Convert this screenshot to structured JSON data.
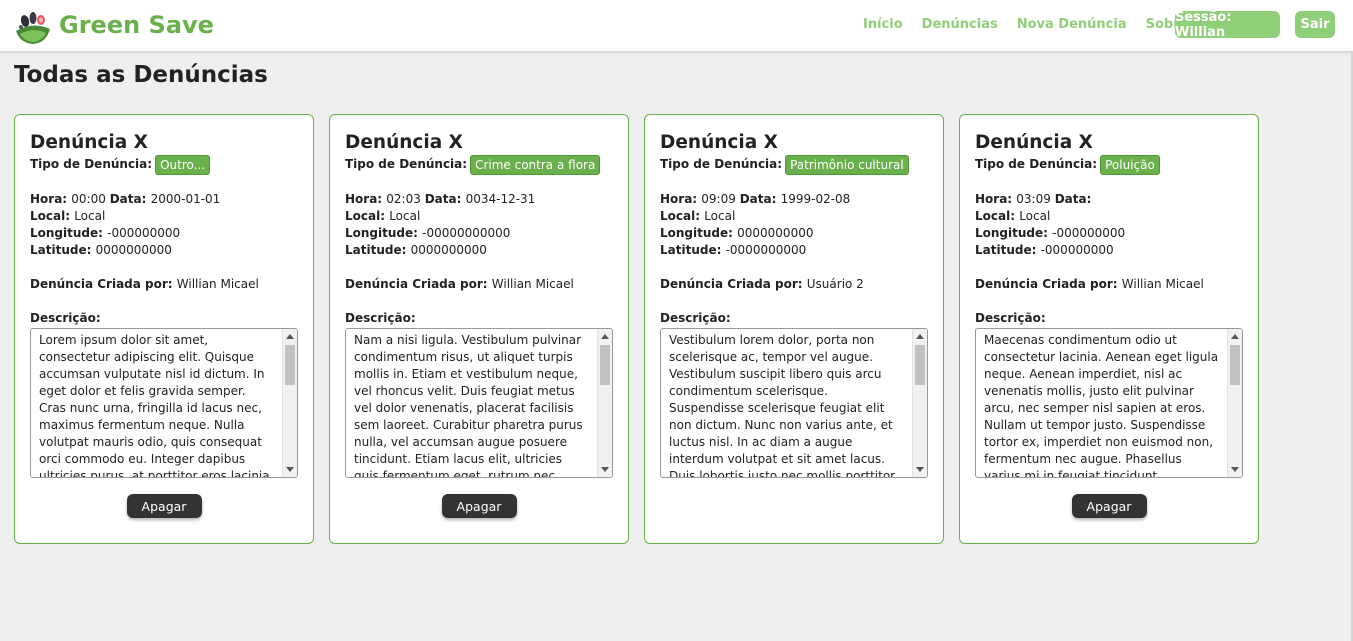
{
  "header": {
    "brand": "Green Save",
    "nav": [
      "Início",
      "Denúncias",
      "Nova Denúncia",
      "Sobre"
    ],
    "session_label": "Sessão: Willian",
    "logout_label": "Sair"
  },
  "page": {
    "title": "Todas as Denúncias"
  },
  "labels": {
    "tipo": "Tipo de Denúncia:",
    "hora": "Hora:",
    "data": "Data:",
    "local": "Local:",
    "longitude": "Longitude:",
    "latitude": "Latitude:",
    "criada_por": "Denúncia Criada por:",
    "descricao": "Descrição:"
  },
  "cards": [
    {
      "title": "Denúncia X",
      "tipo": "Outro...",
      "hora": "00:00",
      "data": "2000-01-01",
      "local": "Local",
      "longitude": "-000000000",
      "latitude": "0000000000",
      "criada_por": "Willian Micael",
      "descricao": "Lorem ipsum dolor sit amet, consectetur adipiscing elit. Quisque accumsan vulputate nisl id dictum. In eget dolor et felis gravida semper. Cras nunc urna, fringilla id lacus nec, maximus fermentum neque. Nulla volutpat mauris odio, quis consequat orci commodo eu. Integer dapibus ultricies purus, at porttitor eros lacinia eu. Donec lacinia",
      "delete_label": "Apagar",
      "show_delete": true
    },
    {
      "title": "Denúncia X",
      "tipo": "Crime contra a flora",
      "hora": "02:03",
      "data": "0034-12-31",
      "local": "Local",
      "longitude": "-00000000000",
      "latitude": "0000000000",
      "criada_por": "Willian Micael",
      "descricao": "Nam a nisi ligula. Vestibulum pulvinar condimentum risus, ut aliquet turpis mollis in. Etiam et vestibulum neque, vel rhoncus velit. Duis feugiat metus vel dolor venenatis, placerat facilisis sem laoreet. Curabitur pharetra purus nulla, vel accumsan augue posuere tincidunt. Etiam lacus elit, ultricies quis fermentum eget, rutrum nec dolor. Integer a arcu est",
      "delete_label": "Apagar",
      "show_delete": true
    },
    {
      "title": "Denúncia X",
      "tipo": "Patrimônio cultural",
      "hora": "09:09",
      "data": "1999-02-08",
      "local": "Local",
      "longitude": "0000000000",
      "latitude": "-0000000000",
      "criada_por": "Usuário 2",
      "descricao": "Vestibulum lorem dolor, porta non scelerisque ac, tempor vel augue. Vestibulum suscipit libero quis arcu condimentum scelerisque. Suspendisse scelerisque feugiat elit non dictum. Nunc non varius ante, et luctus nisl. In ac diam a augue interdum volutpat et sit amet lacus. Duis lobortis justo nec mollis porttitor. Phasellus tempor varius dolor",
      "delete_label": "",
      "show_delete": false
    },
    {
      "title": "Denúncia X",
      "tipo": "Poluição",
      "hora": "03:09",
      "data": "",
      "local": "Local",
      "longitude": "-000000000",
      "latitude": "-000000000",
      "criada_por": "Willian Micael",
      "descricao": "Maecenas condimentum odio ut consectetur lacinia. Aenean eget ligula neque. Aenean imperdiet, nisl ac venenatis mollis, justo elit pulvinar arcu, nec semper nisl sapien at eros. Nullam ut tempor justo. Suspendisse tortor ex, imperdiet non euismod non, fermentum nec augue. Phasellus varius mi in feugiat tincidunt. Pellentesque sit amet felis nec",
      "delete_label": "Apagar",
      "show_delete": true
    }
  ],
  "colors": {
    "brand": "#6ab04c",
    "accent_light": "#8fcf78",
    "dark_button": "#333333"
  }
}
